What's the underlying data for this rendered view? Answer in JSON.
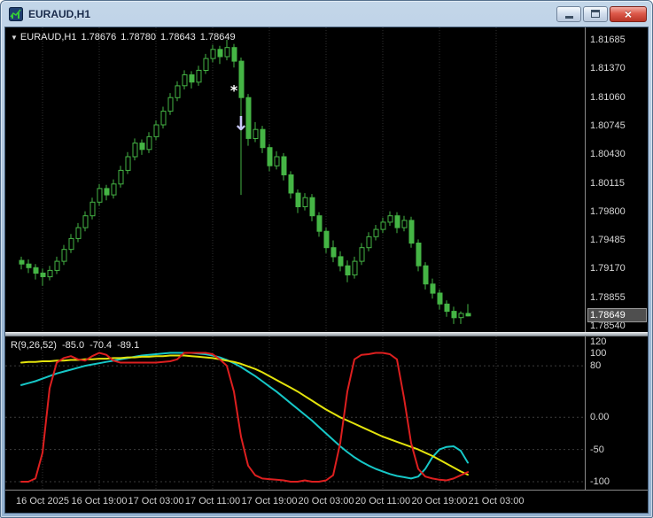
{
  "window": {
    "title": "EURAUD,H1",
    "close_glyph": "×"
  },
  "chart": {
    "header": {
      "triangle": "▼",
      "symbol_period": "EURAUD,H1",
      "open": "1.78676",
      "high": "1.78780",
      "low": "1.78643",
      "close": "1.78649"
    },
    "price_axis": {
      "labels": [
        "1.81685",
        "1.81370",
        "1.81060",
        "1.80745",
        "1.80430",
        "1.80115",
        "1.79800",
        "1.79485",
        "1.79170",
        "1.78855",
        "1.78540"
      ],
      "current_price": "1.78649"
    },
    "time_axis": {
      "labels": [
        "16 Oct 2025",
        "16 Oct 19:00",
        "17 Oct 03:00",
        "17 Oct 11:00",
        "17 Oct 19:00",
        "20 Oct 03:00",
        "20 Oct 11:00",
        "20 Oct 19:00",
        "21 Oct 03:00"
      ]
    }
  },
  "indicator": {
    "name": "R(9,26,52)",
    "values": [
      "-85.0",
      "-70.4",
      "-89.1"
    ],
    "axis_labels": [
      "120",
      "100",
      "80",
      "0.00",
      "-50",
      "-100"
    ],
    "axis_values": [
      120,
      100,
      80,
      0,
      -50,
      -100
    ]
  },
  "colors": {
    "background": "#000000",
    "grid": "#2f2f2f",
    "level": "#3d3d3d",
    "candle": "#45b545",
    "axis_text": "#d6d6d6",
    "current_price_bg": "#4f4f4f",
    "line_red": "#dd1f1f",
    "line_cyan": "#16c7c7",
    "line_yellow": "#e3e30c"
  },
  "chart_data": [
    {
      "type": "candlestick",
      "title": "EURAUD,H1",
      "y_axis": {
        "min": 1.7854,
        "max": 1.81685
      },
      "grid_bars": [
        3,
        11,
        19,
        27,
        35,
        43,
        51,
        59,
        67
      ],
      "x_labels": [
        "16 Oct 2025",
        "16 Oct 19:00",
        "17 Oct 03:00",
        "17 Oct 11:00",
        "17 Oct 19:00",
        "20 Oct 03:00",
        "20 Oct 11:00",
        "20 Oct 19:00",
        "21 Oct 03:00"
      ],
      "ohlc": [
        [
          1.7926,
          1.793,
          1.7916,
          1.7922
        ],
        [
          1.7922,
          1.7927,
          1.7912,
          1.7918
        ],
        [
          1.7918,
          1.7922,
          1.7905,
          1.7912
        ],
        [
          1.7912,
          1.7917,
          1.7898,
          1.7908
        ],
        [
          1.7908,
          1.792,
          1.7904,
          1.7915
        ],
        [
          1.7915,
          1.793,
          1.7911,
          1.7925
        ],
        [
          1.7925,
          1.7943,
          1.7921,
          1.7938
        ],
        [
          1.7938,
          1.7955,
          1.7934,
          1.795
        ],
        [
          1.795,
          1.7967,
          1.7946,
          1.7962
        ],
        [
          1.7962,
          1.798,
          1.7958,
          1.7975
        ],
        [
          1.7975,
          1.7995,
          1.7971,
          1.799
        ],
        [
          1.799,
          1.801,
          1.7986,
          1.8005
        ],
        [
          1.8005,
          1.8009,
          1.7992,
          1.7998
        ],
        [
          1.7998,
          1.8015,
          1.7994,
          1.801
        ],
        [
          1.801,
          1.803,
          1.8006,
          1.8025
        ],
        [
          1.8025,
          1.8045,
          1.8021,
          1.804
        ],
        [
          1.804,
          1.806,
          1.8036,
          1.8055
        ],
        [
          1.8055,
          1.8059,
          1.8042,
          1.8048
        ],
        [
          1.8048,
          1.8067,
          1.8044,
          1.8062
        ],
        [
          1.8062,
          1.808,
          1.8058,
          1.8075
        ],
        [
          1.8075,
          1.8095,
          1.8071,
          1.809
        ],
        [
          1.809,
          1.811,
          1.8086,
          1.8105
        ],
        [
          1.8105,
          1.8123,
          1.8101,
          1.8118
        ],
        [
          1.8118,
          1.8135,
          1.8114,
          1.813
        ],
        [
          1.813,
          1.8134,
          1.8115,
          1.8122
        ],
        [
          1.8122,
          1.814,
          1.8118,
          1.8135
        ],
        [
          1.8135,
          1.8153,
          1.8131,
          1.8148
        ],
        [
          1.8148,
          1.8163,
          1.8144,
          1.8158
        ],
        [
          1.8158,
          1.8162,
          1.8142,
          1.815
        ],
        [
          1.815,
          1.81685,
          1.8146,
          1.816
        ],
        [
          1.816,
          1.8164,
          1.8138,
          1.8145
        ],
        [
          1.8145,
          1.8149,
          1.7998,
          1.8105
        ],
        [
          1.8105,
          1.8109,
          1.8052,
          1.806
        ],
        [
          1.806,
          1.8078,
          1.8056,
          1.807
        ],
        [
          1.807,
          1.8074,
          1.8044,
          1.805
        ],
        [
          1.805,
          1.8054,
          1.8024,
          1.803
        ],
        [
          1.803,
          1.8046,
          1.8026,
          1.804
        ],
        [
          1.804,
          1.8044,
          1.8014,
          1.802
        ],
        [
          1.802,
          1.8024,
          1.7994,
          1.8
        ],
        [
          1.8,
          1.8004,
          1.7978,
          1.7985
        ],
        [
          1.7985,
          1.8,
          1.7981,
          1.7995
        ],
        [
          1.7995,
          1.7999,
          1.7969,
          1.7975
        ],
        [
          1.7975,
          1.7979,
          1.7952,
          1.7958
        ],
        [
          1.7958,
          1.7962,
          1.7934,
          1.794
        ],
        [
          1.794,
          1.7948,
          1.7924,
          1.793
        ],
        [
          1.793,
          1.7936,
          1.7914,
          1.792
        ],
        [
          1.792,
          1.7926,
          1.7902,
          1.791
        ],
        [
          1.791,
          1.793,
          1.7906,
          1.7925
        ],
        [
          1.7925,
          1.7945,
          1.7921,
          1.794
        ],
        [
          1.794,
          1.7957,
          1.7936,
          1.7952
        ],
        [
          1.7952,
          1.7965,
          1.7948,
          1.796
        ],
        [
          1.796,
          1.7973,
          1.7956,
          1.7968
        ],
        [
          1.7968,
          1.798,
          1.7964,
          1.7975
        ],
        [
          1.7975,
          1.7979,
          1.7956,
          1.7962
        ],
        [
          1.7962,
          1.7975,
          1.7958,
          1.797
        ],
        [
          1.797,
          1.7974,
          1.794,
          1.7945
        ],
        [
          1.7945,
          1.7949,
          1.7914,
          1.792
        ],
        [
          1.792,
          1.7924,
          1.7894,
          1.79
        ],
        [
          1.79,
          1.7906,
          1.7884,
          1.789
        ],
        [
          1.789,
          1.7894,
          1.7872,
          1.7878
        ],
        [
          1.7878,
          1.7882,
          1.7864,
          1.787
        ],
        [
          1.787,
          1.7875,
          1.7856,
          1.7863
        ],
        [
          1.7863,
          1.787,
          1.7856,
          1.78676
        ],
        [
          1.78676,
          1.7878,
          1.78643,
          1.78649
        ]
      ],
      "annotations": [
        {
          "type": "star-marker",
          "glyph": "*",
          "bar": 30,
          "price": 1.8112,
          "color": "#ffffff",
          "size": 16
        },
        {
          "type": "sell-arrow",
          "glyph": "↓",
          "bar": 31,
          "price": 1.8075,
          "color": "#c8c8f8",
          "size": 22
        }
      ]
    },
    {
      "type": "line",
      "title": "R(9,26,52)",
      "y_range": [
        -105,
        125
      ],
      "levels_dashed": [
        80,
        0,
        -50,
        -100
      ],
      "series": [
        {
          "name": "line2-cyan",
          "color": "#16c7c7",
          "width": 2,
          "current_value": "-70.4",
          "values": [
            50,
            53,
            56,
            60,
            64,
            68,
            71,
            74,
            77,
            80,
            82,
            84,
            86,
            88,
            90,
            92,
            94,
            96,
            97,
            98,
            99,
            100,
            100,
            100,
            100,
            99,
            98,
            96,
            93,
            89,
            84,
            78,
            71,
            64,
            56,
            48,
            40,
            31,
            22,
            13,
            4,
            -5,
            -15,
            -25,
            -35,
            -45,
            -54,
            -62,
            -69,
            -75,
            -80,
            -84,
            -88,
            -91,
            -93,
            -95,
            -92,
            -80,
            -62,
            -50,
            -46,
            -45,
            -52,
            -70.4
          ]
        },
        {
          "name": "line3-yellow",
          "color": "#e3e30c",
          "width": 2,
          "current_value": "-89.1",
          "values": [
            85,
            86,
            86,
            87,
            87,
            88,
            88,
            89,
            89,
            90,
            90,
            91,
            91,
            92,
            92,
            93,
            93,
            94,
            94,
            95,
            95,
            96,
            96,
            96,
            95,
            94,
            93,
            92,
            90,
            88,
            86,
            83,
            79,
            75,
            70,
            64,
            58,
            52,
            46,
            40,
            33,
            26,
            19,
            12,
            6,
            0,
            -5,
            -10,
            -15,
            -20,
            -25,
            -30,
            -34,
            -38,
            -42,
            -46,
            -50,
            -55,
            -60,
            -66,
            -72,
            -78,
            -84,
            -89.1
          ]
        },
        {
          "name": "line1-red",
          "color": "#dd1f1f",
          "width": 2,
          "current_value": "-85.0",
          "values": [
            -100,
            -100,
            -95,
            -55,
            45,
            85,
            92,
            95,
            90,
            88,
            95,
            100,
            97,
            88,
            85,
            85,
            85,
            85,
            85,
            85,
            86,
            87,
            90,
            100,
            100,
            100,
            100,
            98,
            90,
            80,
            40,
            -30,
            -75,
            -90,
            -95,
            -96,
            -97,
            -98,
            -100,
            -100,
            -98,
            -100,
            -100,
            -98,
            -90,
            -40,
            40,
            90,
            97,
            98,
            100,
            100,
            98,
            90,
            30,
            -40,
            -80,
            -92,
            -95,
            -97,
            -98,
            -95,
            -90,
            -85
          ]
        }
      ]
    }
  ]
}
